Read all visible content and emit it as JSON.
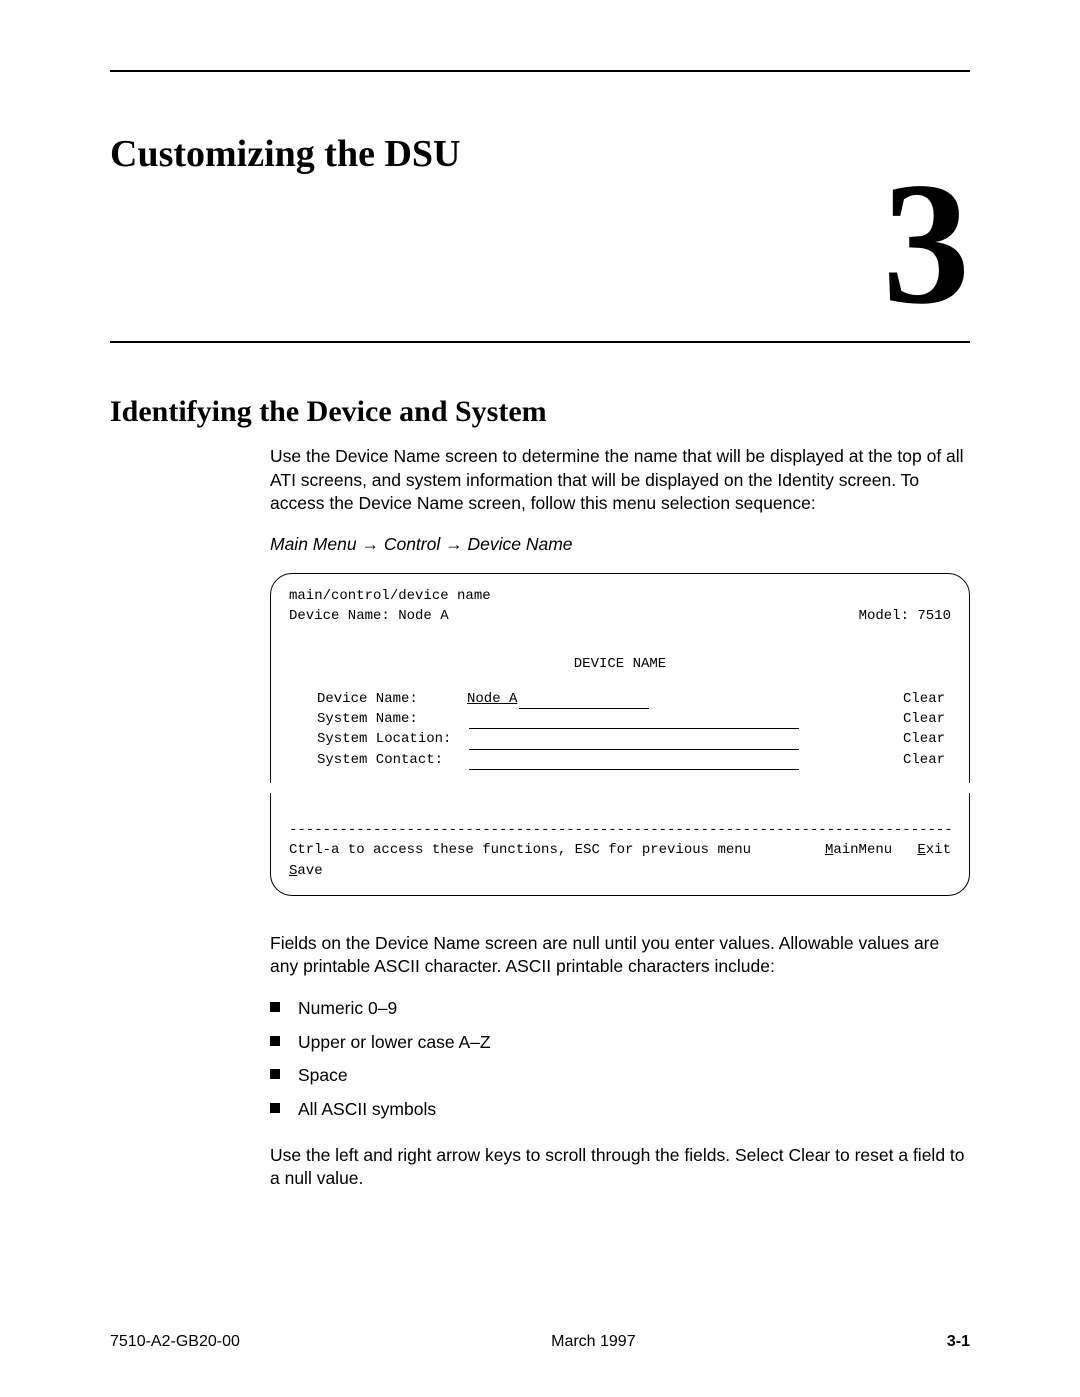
{
  "chapter_title": "Customizing the DSU",
  "chapter_number": "3",
  "section_title": "Identifying the Device and System",
  "intro_paragraph": "Use the Device Name screen to determine the name that will be displayed at the top of all ATI screens, and system information that will be displayed on the Identity screen. To access the Device Name screen, follow this menu selection sequence:",
  "menu_path": {
    "segments": [
      "Main Menu",
      "Control",
      "Device Name"
    ],
    "arrow": "→"
  },
  "terminal": {
    "breadcrumb": "main/control/device name",
    "device_line": "Device Name: Node A",
    "model": "Model: 7510",
    "screen_title": "DEVICE NAME",
    "fields": [
      {
        "label": "Device Name:",
        "value": "Node A",
        "underline": "short",
        "action": "Clear"
      },
      {
        "label": "System Name:",
        "value": "",
        "underline": "long",
        "action": "Clear"
      },
      {
        "label": "System Location:",
        "value": "",
        "underline": "long",
        "action": "Clear"
      },
      {
        "label": "System Contact:",
        "value": "",
        "underline": "long",
        "action": "Clear"
      }
    ],
    "divider": "---------------------------------------------------------------------------------",
    "footer_hint": "Ctrl-a to access these functions, ESC for previous menu",
    "footer_menu_u": "M",
    "footer_menu_rest": "ainMenu",
    "footer_exit_u": "E",
    "footer_exit_rest": "xit",
    "footer_save_u": "S",
    "footer_save_rest": "ave"
  },
  "after_terminal": "Fields on the Device Name screen are null until you enter values. Allowable values are any printable ASCII character. ASCII printable characters include:",
  "bullets": [
    "Numeric 0–9",
    "Upper or lower case A–Z",
    "Space",
    "All ASCII symbols"
  ],
  "closing_paragraph": "Use the left and right arrow keys to scroll through the fields. Select Clear to reset a field to a null value.",
  "footer": {
    "left": "7510-A2-GB20-00",
    "center": "March 1997",
    "right": "3-1"
  }
}
